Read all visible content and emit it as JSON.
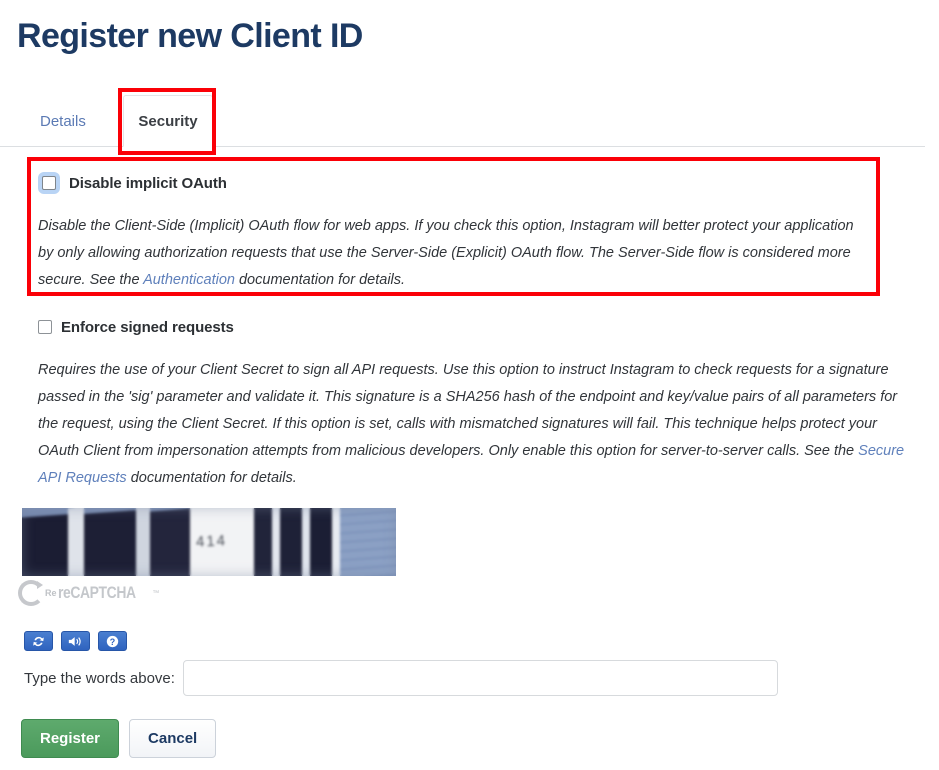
{
  "page": {
    "title": "Register new Client ID"
  },
  "tabs": [
    {
      "label": "Details",
      "active": false
    },
    {
      "label": "Security",
      "active": true
    }
  ],
  "options": [
    {
      "id": "disable-implicit-oauth",
      "label": "Disable implicit OAuth",
      "checked": false,
      "focused": true,
      "description_parts": [
        {
          "type": "text",
          "value": "Disable the Client-Side (Implicit) OAuth flow for web apps. If you check this option, Instagram will better protect your application by only allowing authorization requests that use the Server-Side (Explicit) OAuth flow. The Server-Side flow is considered more secure. See the "
        },
        {
          "type": "link",
          "value": "Authentication"
        },
        {
          "type": "text",
          "value": " documentation for details."
        }
      ]
    },
    {
      "id": "enforce-signed-requests",
      "label": "Enforce signed requests",
      "checked": false,
      "focused": false,
      "description_parts": [
        {
          "type": "text",
          "value": "Requires the use of your Client Secret to sign all API requests. Use this option to instruct Instagram to check requests for a signature passed in the 'sig' parameter and validate it. This signature is a SHA256 hash of the endpoint and key/value pairs of all parameters for the request, using the Client Secret. If this option is set, calls with mismatched signatures will fail. This technique helps protect your OAuth Client from impersonation attempts from malicious developers. Only enable this option for server-to-server calls. See the "
        },
        {
          "type": "link",
          "value": "Secure API Requests"
        },
        {
          "type": "text",
          "value": " documentation for details."
        }
      ]
    }
  ],
  "captcha": {
    "image_text": "414",
    "brand": "reCAPTCHA",
    "brand_prefix": "Re",
    "trademark": "™",
    "buttons": [
      {
        "name": "refresh-challenge",
        "icon": "refresh-icon"
      },
      {
        "name": "audio-challenge",
        "icon": "speaker-icon"
      },
      {
        "name": "captcha-help",
        "icon": "question-icon"
      }
    ],
    "input_label": "Type the words above:",
    "input_value": "",
    "input_placeholder": ""
  },
  "footer": {
    "register_label": "Register",
    "cancel_label": "Cancel"
  },
  "colors": {
    "title": "#1d3a63",
    "link": "#5f80bb",
    "annotation": "#fb0007",
    "register_button": "#4b9a5c",
    "captcha_button": "#2f63bf",
    "tab_inactive": "#5b7ab4"
  }
}
